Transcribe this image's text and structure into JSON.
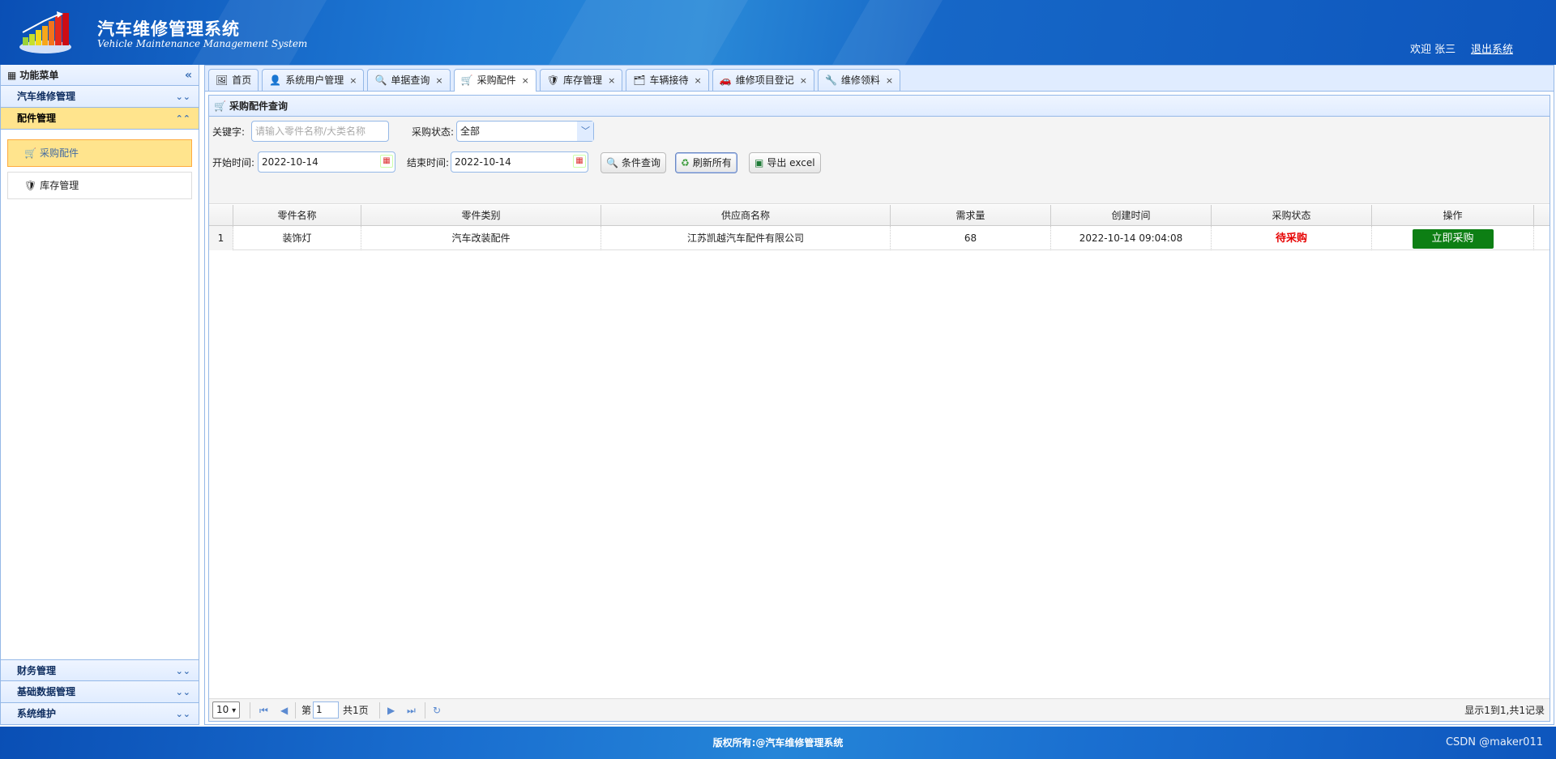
{
  "header": {
    "title": "汽车维修管理系统",
    "subtitle": "Vehicle Maintenance Management System",
    "welcome": "欢迎 张三",
    "logout": "退出系统"
  },
  "sidebar": {
    "title": "功能菜单",
    "sections": [
      {
        "label": "汽车维修管理"
      },
      {
        "label": "配件管理"
      },
      {
        "label": "财务管理"
      },
      {
        "label": "基础数据管理"
      },
      {
        "label": "系统维护"
      }
    ],
    "items": [
      {
        "label": "采购配件"
      },
      {
        "label": "库存管理"
      }
    ]
  },
  "tabs": [
    {
      "label": "首页",
      "icon": "home-icon"
    },
    {
      "label": "系统用户管理",
      "icon": "user-icon"
    },
    {
      "label": "单据查询",
      "icon": "search-icon"
    },
    {
      "label": "采购配件",
      "icon": "cart-icon"
    },
    {
      "label": "库存管理",
      "icon": "shield-icon"
    },
    {
      "label": "车辆接待",
      "icon": "card-icon"
    },
    {
      "label": "维修项目登记",
      "icon": "car-icon"
    },
    {
      "label": "维修领料",
      "icon": "tool-icon"
    }
  ],
  "panel": {
    "title": "采购配件查询"
  },
  "filters": {
    "keyword_label": "关键字:",
    "keyword_placeholder": "请输入零件名称/大类名称",
    "status_label": "采购状态:",
    "status_value": "全部",
    "start_label": "开始时间:",
    "start_value": "2022-10-14",
    "end_label": "结束时间:",
    "end_value": "2022-10-14",
    "search_btn": "条件查询",
    "refresh_btn": "刷新所有",
    "export_btn": "导出 excel"
  },
  "table": {
    "columns": [
      "零件名称",
      "零件类别",
      "供应商名称",
      "需求量",
      "创建时间",
      "采购状态",
      "操作"
    ],
    "rows": [
      {
        "num": "1",
        "name": "装饰灯",
        "category": "汽车改装配件",
        "supplier": "江苏凯越汽车配件有限公司",
        "qty": "68",
        "created": "2022-10-14 09:04:08",
        "status": "待采购",
        "action": "立即采购"
      }
    ]
  },
  "pager": {
    "page_size": "10",
    "page_prefix": "第",
    "page_value": "1",
    "page_total": "共1页",
    "summary": "显示1到1,共1记录"
  },
  "footer": {
    "copyright": "版权所有:@汽车维修管理系统",
    "watermark": "CSDN @maker011"
  }
}
